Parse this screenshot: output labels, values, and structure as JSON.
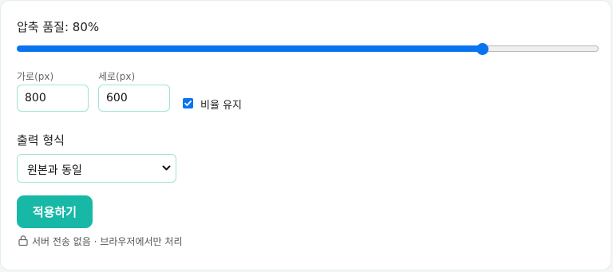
{
  "quality": {
    "label": "압축 품질: 80%",
    "value_percent": 80,
    "fill_color": "#0a74f0"
  },
  "dimensions": {
    "width_label": "가로(px)",
    "width_value": "800",
    "height_label": "세로(px)",
    "height_value": "600",
    "keep_ratio_label": "비율 유지",
    "keep_ratio_checked": true
  },
  "format": {
    "label": "출력 형식",
    "selected": "원본과 동일"
  },
  "actions": {
    "apply_label": "적용하기",
    "apply_color": "#17b8a6"
  },
  "footer": {
    "privacy_text": "서버 전송 없음 · 브라우저에서만 처리",
    "icon": "lock-icon"
  }
}
